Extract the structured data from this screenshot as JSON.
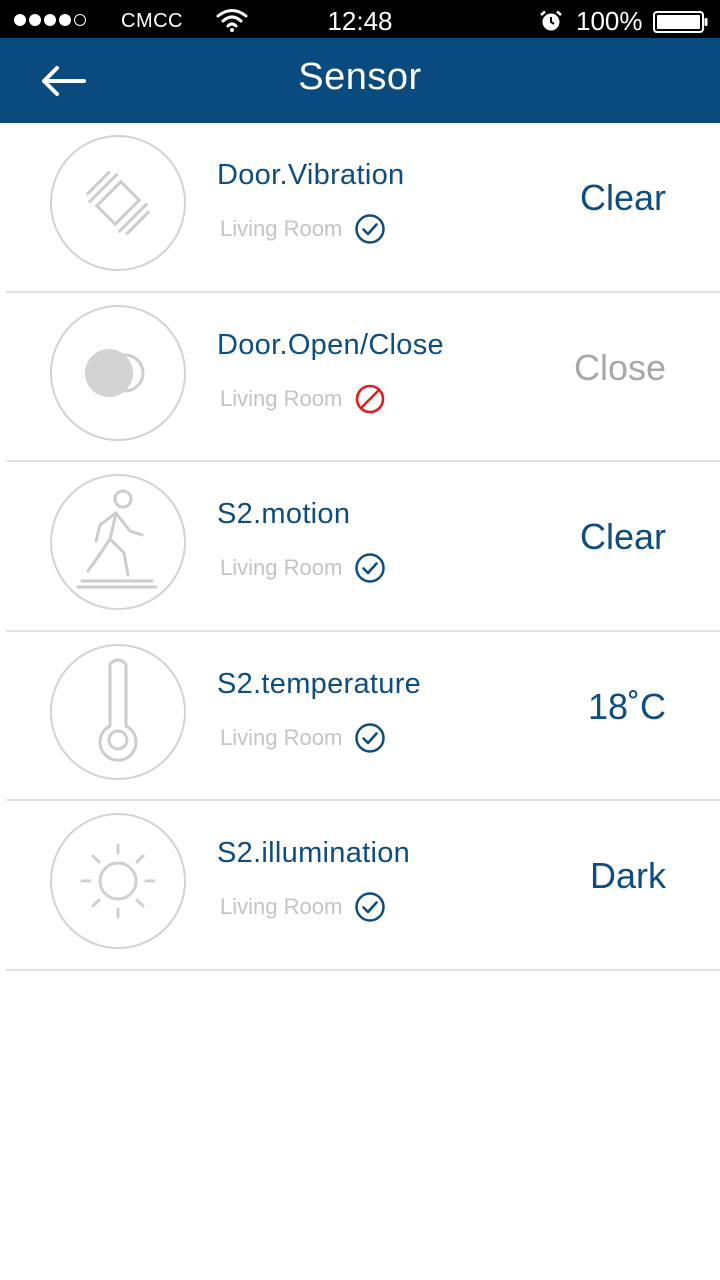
{
  "status_bar": {
    "carrier": "CMCC",
    "time": "12:48",
    "battery": "100%"
  },
  "nav": {
    "title": "Sensor",
    "back_icon": "arrow-left-icon"
  },
  "colors": {
    "nav_background": "#0a4b7f",
    "primary_text": "#0e4d7d",
    "muted_text": "#a8a8a8",
    "room_text": "#c4c4c4",
    "ok_icon": "#0e4d7d",
    "disabled_icon": "#e02020"
  },
  "sensors": [
    {
      "name": "Door.Vibration",
      "room": "Living Room",
      "status_icon": "check-circle-icon",
      "value": "Clear",
      "icon": "vibration-icon"
    },
    {
      "name": "Door.Open/Close",
      "room": "Living Room",
      "status_icon": "prohibited-icon",
      "value": "Close",
      "icon": "door-contact-icon"
    },
    {
      "name": "S2.motion",
      "room": "Living Room",
      "status_icon": "check-circle-icon",
      "value": "Clear",
      "icon": "walking-person-icon"
    },
    {
      "name": "S2.temperature",
      "room": "Living Room",
      "status_icon": "check-circle-icon",
      "value": "18˚C",
      "icon": "thermometer-icon"
    },
    {
      "name": "S2.illumination",
      "room": "Living Room",
      "status_icon": "check-circle-icon",
      "value": "Dark",
      "icon": "sun-icon"
    }
  ]
}
